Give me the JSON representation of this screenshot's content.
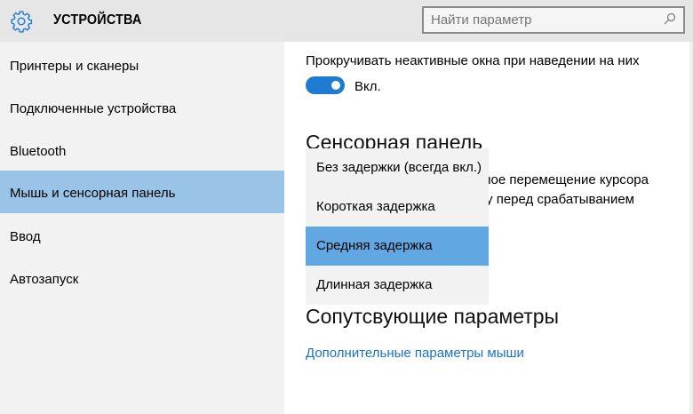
{
  "header": {
    "title": "УСТРОЙСТВА",
    "search_placeholder": "Найти параметр"
  },
  "sidebar": {
    "items": [
      {
        "label": "Принтеры и сканеры"
      },
      {
        "label": "Подключенные устройства"
      },
      {
        "label": "Bluetooth"
      },
      {
        "label": "Мышь и сенсорная панель",
        "selected": true
      },
      {
        "label": "Ввод"
      },
      {
        "label": "Автозапуск"
      }
    ]
  },
  "content": {
    "scroll_label": "Прокручивать неактивные окна при наведении на них",
    "toggle_state": "Вкл.",
    "touchpad_heading": "Сенсорная панель",
    "touchpad_desc_line1": "ное перемещение курсора",
    "touchpad_desc_line2": "у перед срабатыванием",
    "related_heading": "Сопутсвующие параметры",
    "mouse_link": "Дополнительные параметры мыши"
  },
  "dropdown": {
    "options": [
      {
        "label": "Без задержки (всегда вкл.)"
      },
      {
        "label": "Короткая задержка"
      },
      {
        "label": "Средняя задержка",
        "selected": true
      },
      {
        "label": "Длинная задержка"
      }
    ]
  },
  "colors": {
    "accent": "#1f7ad1",
    "selected_nav": "#99c4e8",
    "selected_option": "#61a7e1"
  }
}
